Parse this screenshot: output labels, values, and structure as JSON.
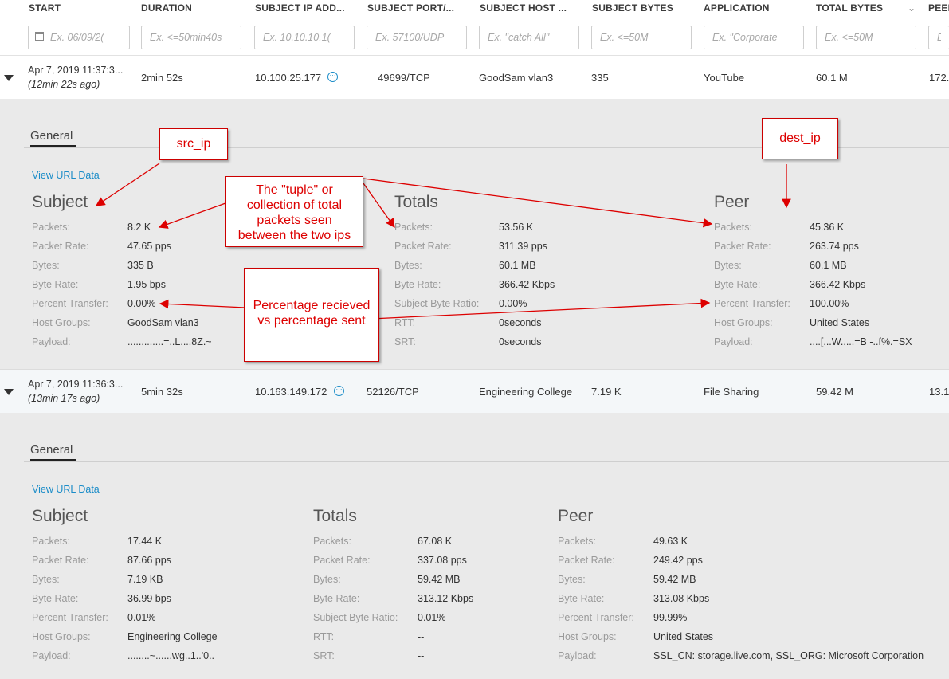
{
  "columns": [
    "START",
    "DURATION",
    "SUBJECT IP ADD...",
    "SUBJECT PORT/...",
    "SUBJECT HOST ...",
    "SUBJECT BYTES",
    "APPLICATION",
    "TOTAL BYTES",
    "PEEI"
  ],
  "filters": [
    "Ex. 06/09/2(",
    "Ex. <=50min40s",
    "Ex. 10.10.10.1(",
    "Ex. 57100/UDP",
    "Ex. \"catch All\"",
    "Ex. <=50M",
    "Ex. \"Corporate",
    "Ex. <=50M",
    "Ex"
  ],
  "flows": [
    {
      "start": "Apr 7, 2019 11:37:3...",
      "ago": "(12min 22s ago)",
      "duration": "2min 52s",
      "subject_ip": "10.100.25.177",
      "port": "49699/TCP",
      "host": "GoodSam vlan3",
      "subject_bytes": "335",
      "application": "YouTube",
      "total_bytes": "60.1 M",
      "peer": "172.",
      "details": {
        "tab": "General",
        "url_link": "View URL Data",
        "subject_title": "Subject",
        "totals_title": "Totals",
        "peer_title": "Peer",
        "subject": [
          {
            "label": "Packets:",
            "value": "8.2 K"
          },
          {
            "label": "Packet Rate:",
            "value": "47.65 pps"
          },
          {
            "label": "Bytes:",
            "value": "335 B"
          },
          {
            "label": "Byte Rate:",
            "value": "1.95 bps"
          },
          {
            "label": "Percent Transfer:",
            "value": "0.00%"
          },
          {
            "label": "Host Groups:",
            "value": "GoodSam vlan3"
          },
          {
            "label": "Payload:",
            "value": ".............=..L....8Z.~"
          }
        ],
        "totals": [
          {
            "label": "Packets:",
            "value": "53.56 K"
          },
          {
            "label": "Packet Rate:",
            "value": "311.39 pps"
          },
          {
            "label": "Bytes:",
            "value": "60.1 MB"
          },
          {
            "label": "Byte Rate:",
            "value": "366.42 Kbps"
          },
          {
            "label": "Subject Byte Ratio:",
            "value": "0.00%"
          },
          {
            "label": "RTT:",
            "value": "0seconds"
          },
          {
            "label": "SRT:",
            "value": "0seconds"
          }
        ],
        "peer": [
          {
            "label": "Packets:",
            "value": "45.36 K"
          },
          {
            "label": "Packet Rate:",
            "value": "263.74 pps"
          },
          {
            "label": "Bytes:",
            "value": "60.1 MB"
          },
          {
            "label": "Byte Rate:",
            "value": "366.42 Kbps"
          },
          {
            "label": "Percent Transfer:",
            "value": "100.00%"
          },
          {
            "label": "Host Groups:",
            "value": "United States"
          },
          {
            "label": "Payload:",
            "value": "....[...W.....=B -..f%.=SX"
          }
        ]
      }
    },
    {
      "start": "Apr 7, 2019 11:36:3...",
      "ago": "(13min 17s ago)",
      "duration": "5min 32s",
      "subject_ip": "10.163.149.172",
      "port": "52126/TCP",
      "host": "Engineering College",
      "subject_bytes": "7.19 K",
      "application": "File Sharing",
      "total_bytes": "59.42 M",
      "peer": "13.1",
      "details": {
        "tab": "General",
        "url_link": "View URL Data",
        "subject_title": "Subject",
        "totals_title": "Totals",
        "peer_title": "Peer",
        "subject": [
          {
            "label": "Packets:",
            "value": "17.44 K"
          },
          {
            "label": "Packet Rate:",
            "value": "87.66 pps"
          },
          {
            "label": "Bytes:",
            "value": "7.19 KB"
          },
          {
            "label": "Byte Rate:",
            "value": "36.99 bps"
          },
          {
            "label": "Percent Transfer:",
            "value": "0.01%"
          },
          {
            "label": "Host Groups:",
            "value": "Engineering College"
          },
          {
            "label": "Payload:",
            "value": "........~......wg..1..'0.."
          }
        ],
        "totals": [
          {
            "label": "Packets:",
            "value": "67.08 K"
          },
          {
            "label": "Packet Rate:",
            "value": "337.08 pps"
          },
          {
            "label": "Bytes:",
            "value": "59.42 MB"
          },
          {
            "label": "Byte Rate:",
            "value": "313.12 Kbps"
          },
          {
            "label": "Subject Byte Ratio:",
            "value": "0.01%"
          },
          {
            "label": "RTT:",
            "value": "--"
          },
          {
            "label": "SRT:",
            "value": "--"
          }
        ],
        "peer": [
          {
            "label": "Packets:",
            "value": "49.63 K"
          },
          {
            "label": "Packet Rate:",
            "value": "249.42 pps"
          },
          {
            "label": "Bytes:",
            "value": "59.42 MB"
          },
          {
            "label": "Byte Rate:",
            "value": "313.08 Kbps"
          },
          {
            "label": "Percent Transfer:",
            "value": "99.99%"
          },
          {
            "label": "Host Groups:",
            "value": "United States"
          },
          {
            "label": "Payload:",
            "value": "SSL_CN: storage.live.com, SSL_ORG: Microsoft Corporation"
          }
        ]
      }
    }
  ],
  "annotations": {
    "src_ip": "src_ip",
    "dest_ip": "dest_ip",
    "tuple": [
      "The \"tuple\" or",
      "collection of total",
      "packets seen",
      "between the two ips"
    ],
    "percentage": [
      "Percentage recieved",
      "vs percentage sent"
    ]
  },
  "icons": {
    "calendar": "calendar-icon",
    "expand": "caret-down-icon",
    "more": "ellipsis-circle-icon",
    "column_menu": "chevron-down-icon"
  },
  "colors": {
    "link": "#1a8cc8",
    "annotation": "#dd0000",
    "panel_bg": "#eaeaea"
  }
}
